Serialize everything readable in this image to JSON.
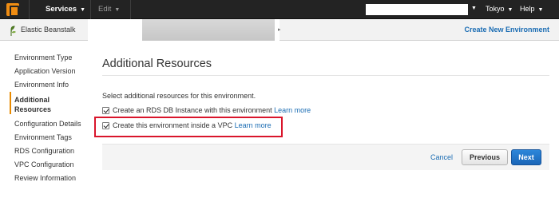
{
  "topbar": {
    "services_label": "Services",
    "edit_label": "Edit",
    "region_label": "Tokyo",
    "help_label": "Help"
  },
  "subbar": {
    "service_name": "Elastic Beanstalk",
    "create_env_label": "Create New Environment"
  },
  "sidebar": {
    "items": [
      {
        "label": "Environment Type"
      },
      {
        "label": "Application Version"
      },
      {
        "label": "Environment Info"
      },
      {
        "label": "Additional"
      },
      {
        "label": "Resources"
      },
      {
        "label": "Configuration Details"
      },
      {
        "label": "Environment Tags"
      },
      {
        "label": "RDS Configuration"
      },
      {
        "label": "VPC Configuration"
      },
      {
        "label": "Review Information"
      }
    ],
    "active_color": "#e88a00"
  },
  "main": {
    "title": "Additional Resources",
    "intro": "Select additional resources for this environment.",
    "options": [
      {
        "label": "Create an RDS DB Instance with this environment",
        "link": "Learn more",
        "checked": true
      },
      {
        "label": "Create this environment inside a VPC",
        "link": "Learn more",
        "checked": true
      }
    ],
    "highlight_color": "#d9152b"
  },
  "footer": {
    "cancel_label": "Cancel",
    "previous_label": "Previous",
    "next_label": "Next"
  },
  "colors": {
    "topbar_bg": "#232323",
    "link": "#1a6cb3",
    "primary_button": "#1b66b8",
    "aws_orange": "#f08d13"
  }
}
